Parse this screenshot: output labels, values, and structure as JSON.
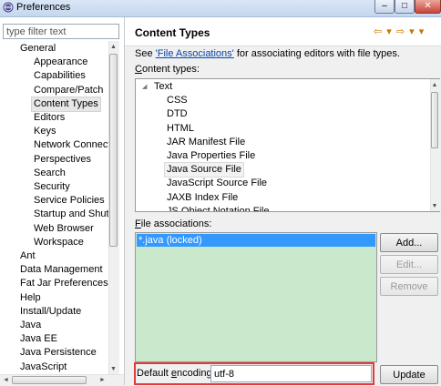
{
  "window": {
    "title": "Preferences",
    "controls": {
      "minimize": "–",
      "maximize": "□",
      "close": "✕"
    }
  },
  "filter": {
    "placeholder": "type filter text"
  },
  "tree": {
    "items": [
      {
        "label": "General",
        "level": 1
      },
      {
        "label": "Appearance",
        "level": 2
      },
      {
        "label": "Capabilities",
        "level": 2
      },
      {
        "label": "Compare/Patch",
        "level": 2
      },
      {
        "label": "Content Types",
        "level": 2,
        "selected": true
      },
      {
        "label": "Editors",
        "level": 2
      },
      {
        "label": "Keys",
        "level": 2
      },
      {
        "label": "Network Connecti",
        "level": 2
      },
      {
        "label": "Perspectives",
        "level": 2
      },
      {
        "label": "Search",
        "level": 2
      },
      {
        "label": "Security",
        "level": 2
      },
      {
        "label": "Service Policies",
        "level": 2
      },
      {
        "label": "Startup and Shutd",
        "level": 2
      },
      {
        "label": "Web Browser",
        "level": 2
      },
      {
        "label": "Workspace",
        "level": 2
      },
      {
        "label": "Ant",
        "level": 1
      },
      {
        "label": "Data Management",
        "level": 1
      },
      {
        "label": "Fat Jar Preferences",
        "level": 1
      },
      {
        "label": "Help",
        "level": 1
      },
      {
        "label": "Install/Update",
        "level": 1
      },
      {
        "label": "Java",
        "level": 1
      },
      {
        "label": "Java EE",
        "level": 1
      },
      {
        "label": "Java Persistence",
        "level": 1
      },
      {
        "label": "JavaScript",
        "level": 1
      }
    ],
    "scroll_arrows": {
      "up": "▲",
      "down": "▼",
      "left": "◄",
      "right": "►"
    }
  },
  "page": {
    "title": "Content Types",
    "nav_icons": "⇦ ▾ ⇨ ▾ ▾",
    "see_prefix": "See ",
    "see_link": "'File Associations'",
    "see_suffix": " for associating editors with file types.",
    "content_types_label_u": "C",
    "content_types_label_rest": "ontent types:",
    "content_types": [
      {
        "label": "Text",
        "level": 1,
        "expanded": true
      },
      {
        "label": "CSS",
        "level": 2
      },
      {
        "label": "DTD",
        "level": 2
      },
      {
        "label": "HTML",
        "level": 2
      },
      {
        "label": "JAR Manifest File",
        "level": 2
      },
      {
        "label": "Java Properties File",
        "level": 2
      },
      {
        "label": "Java Source File",
        "level": 2,
        "hover": true
      },
      {
        "label": "JavaScript Source File",
        "level": 2
      },
      {
        "label": "JAXB Index File",
        "level": 2
      },
      {
        "label": "JS Object Notation File",
        "level": 2
      }
    ],
    "file_assoc_label_u": "F",
    "file_assoc_label_rest": "ile associations:",
    "file_associations": [
      {
        "label": "*.java (locked)",
        "selected": true
      }
    ],
    "buttons": {
      "add": "Add...",
      "edit": "Edit...",
      "remove": "Remove",
      "update": "Update"
    },
    "encoding_label_pre": "Default ",
    "encoding_label_u": "e",
    "encoding_label_post": "ncoding:",
    "encoding_value": "utf-8"
  },
  "colors": {
    "selection": "#3399ff",
    "assoc_bg": "#c9e8cc",
    "highlight_box": "#e23b3b",
    "link": "#0645ad"
  }
}
